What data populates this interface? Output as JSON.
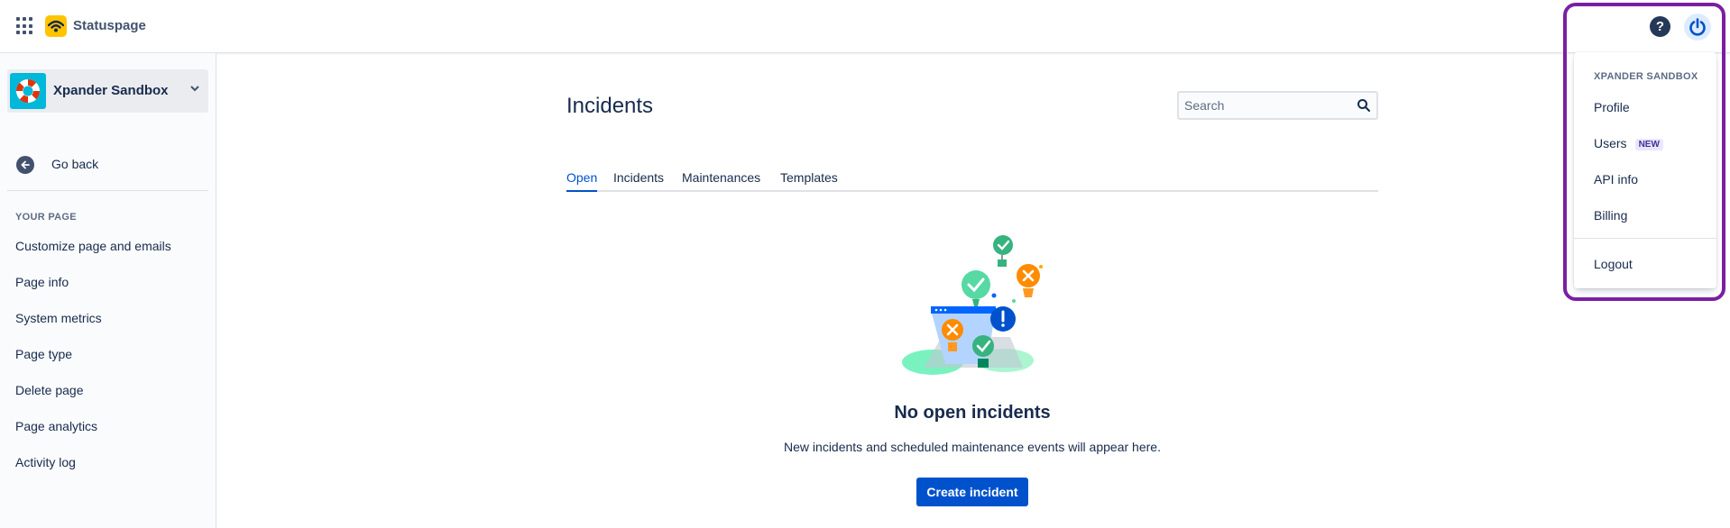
{
  "brand": {
    "name": "Statuspage",
    "accent": "#ffc400"
  },
  "header": {
    "icons": [
      "apps-icon",
      "help-icon",
      "power-icon"
    ]
  },
  "sidebar": {
    "page_name": "Xpander Sandbox",
    "go_back": "Go back",
    "section_title": "YOUR PAGE",
    "items": [
      {
        "label": "Customize page and emails"
      },
      {
        "label": "Page info"
      },
      {
        "label": "System metrics"
      },
      {
        "label": "Page type"
      },
      {
        "label": "Delete page"
      },
      {
        "label": "Page analytics"
      },
      {
        "label": "Activity log"
      }
    ]
  },
  "main": {
    "title": "Incidents",
    "search": {
      "placeholder": "Search",
      "value": ""
    },
    "tabs": [
      {
        "label": "Open",
        "active": true
      },
      {
        "label": "Incidents",
        "active": false
      },
      {
        "label": "Maintenances",
        "active": false
      },
      {
        "label": "Templates",
        "active": false
      }
    ],
    "empty_state": {
      "title": "No open incidents",
      "subtitle": "New incidents and scheduled maintenance events will appear here.",
      "button": "Create incident"
    }
  },
  "dropdown": {
    "heading": "XPANDER SANDBOX",
    "items": [
      {
        "label": "Profile"
      },
      {
        "label": "Users",
        "badge": "NEW"
      },
      {
        "label": "API info"
      },
      {
        "label": "Billing"
      }
    ],
    "logout": "Logout",
    "highlight_color": "#7b1fa2"
  },
  "colors": {
    "primary": "#0052cc",
    "text": "#172b4d",
    "sidebar_bg": "#fafbfc"
  }
}
